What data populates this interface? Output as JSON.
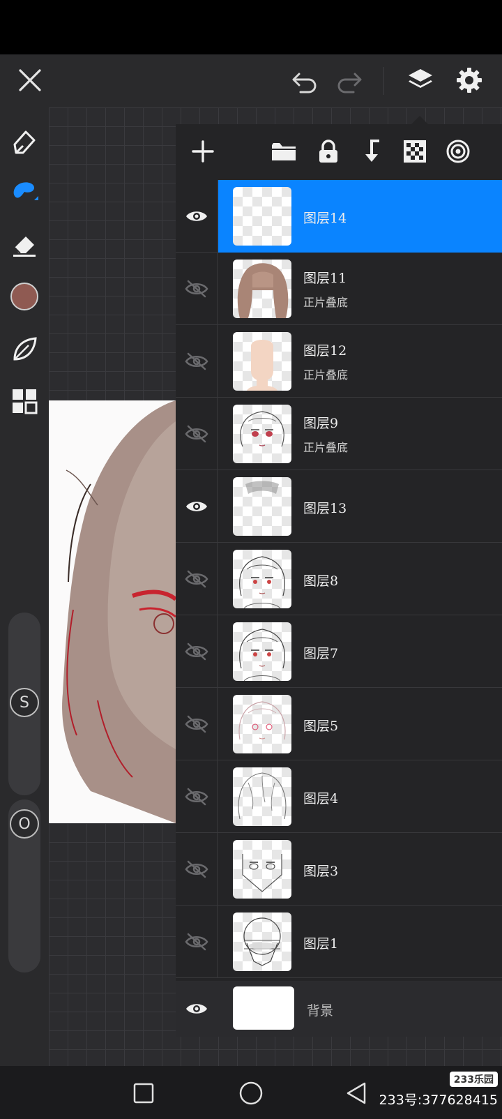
{
  "toolbar": {
    "close_icon": "close-icon",
    "undo_icon": "undo-icon",
    "redo_icon": "redo-icon",
    "layers_icon": "layers-icon",
    "settings_icon": "gear-icon"
  },
  "tools": {
    "items": [
      "pen-icon",
      "brush-icon",
      "eraser-icon",
      "color-swatch",
      "leaf-icon",
      "grid-icon"
    ],
    "color": "#8f5a52",
    "active_color": "#1a8cff",
    "size_label": "S",
    "opacity_label": "O"
  },
  "layers_panel": {
    "toolbar": [
      "add-layer-icon",
      "folder-icon",
      "lock-icon",
      "merge-down-icon",
      "checker-icon",
      "target-icon"
    ],
    "layers": [
      {
        "name": "图层14",
        "mode": "",
        "visible": true,
        "selected": true,
        "thumb": "empty"
      },
      {
        "name": "图层11",
        "mode": "正片叠底",
        "visible": false,
        "selected": false,
        "thumb": "hair"
      },
      {
        "name": "图层12",
        "mode": "正片叠底",
        "visible": false,
        "selected": false,
        "thumb": "skin"
      },
      {
        "name": "图层9",
        "mode": "正片叠底",
        "visible": false,
        "selected": false,
        "thumb": "face-color"
      },
      {
        "name": "图层13",
        "mode": "",
        "visible": true,
        "selected": false,
        "thumb": "shadow"
      },
      {
        "name": "图层8",
        "mode": "",
        "visible": false,
        "selected": false,
        "thumb": "lineart"
      },
      {
        "name": "图层7",
        "mode": "",
        "visible": false,
        "selected": false,
        "thumb": "lineart"
      },
      {
        "name": "图层5",
        "mode": "",
        "visible": false,
        "selected": false,
        "thumb": "sketch-light"
      },
      {
        "name": "图层4",
        "mode": "",
        "visible": false,
        "selected": false,
        "thumb": "sketch-hair"
      },
      {
        "name": "图层3",
        "mode": "",
        "visible": false,
        "selected": false,
        "thumb": "face-guide"
      },
      {
        "name": "图层1",
        "mode": "",
        "visible": false,
        "selected": false,
        "thumb": "head-guide"
      }
    ],
    "background": {
      "name": "背景",
      "visible": true
    }
  },
  "navbar": {
    "recents_icon": "square-icon",
    "home_icon": "circle-icon",
    "back_icon": "triangle-back-icon"
  },
  "watermark": {
    "badge": "233乐园",
    "text": "233号:377628415"
  }
}
